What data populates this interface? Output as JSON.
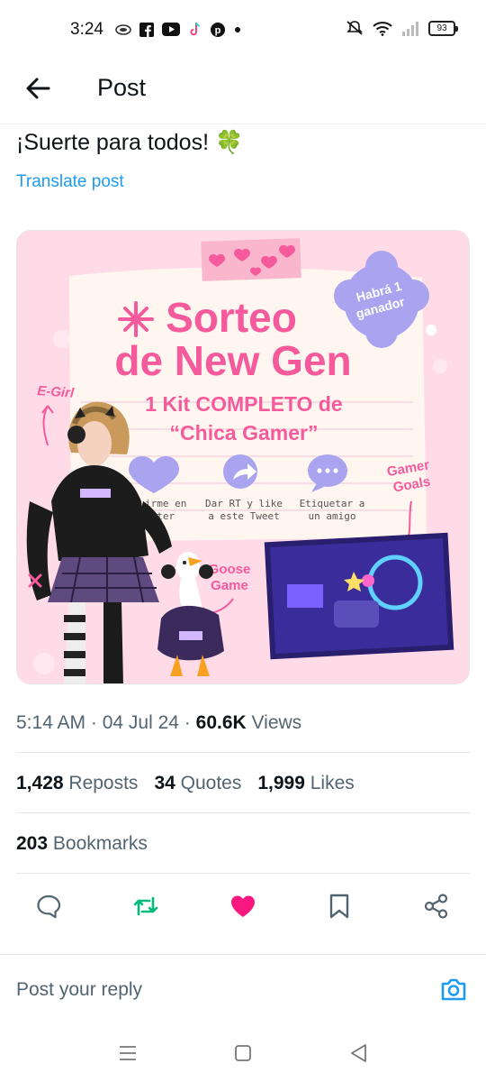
{
  "status_bar": {
    "time": "3:24",
    "battery": "93",
    "left_icons": [
      "cloud-sync-icon",
      "facebook-icon",
      "youtube-icon",
      "tiktok-icon",
      "pinterest-icon",
      "dot-icon"
    ],
    "right_icons": [
      "mute-icon",
      "wifi-icon",
      "signal-icon",
      "battery-icon"
    ]
  },
  "header": {
    "title": "Post"
  },
  "post": {
    "text": "¡Suerte para todos! 🍀",
    "translate_label": "Translate post"
  },
  "media": {
    "title_line1": "Sorteo",
    "title_line2": "de New Gen",
    "subtitle_line1": "1 Kit COMPLETO de",
    "subtitle_line2": "“Chica Gamer”",
    "badge_line1": "Habrá 1",
    "badge_line2": "ganador",
    "step1_line1": "Seguirme en",
    "step1_line2": "Twitter",
    "step2_line1": "Dar RT y like",
    "step2_line2": "a este Tweet",
    "step3_line1": "Etiquetar a",
    "step3_line2": "un amigo",
    "label_egirl": "E-Girl",
    "label_gamer_line1": "Gamer",
    "label_gamer_line2": "Goals",
    "label_goose_line1": "Goose",
    "label_goose_line2": "Game",
    "colors": {
      "background": "#ffdbe8",
      "pink": "#f55b9c",
      "purple": "#a9a3f0"
    }
  },
  "meta": {
    "time": "5:14 AM",
    "sep1": " · ",
    "date": "04 Jul 24",
    "sep2": " · ",
    "views_count": "60.6K",
    "views_label": " Views"
  },
  "stats": {
    "reposts_count": "1,428",
    "reposts_label": " Reposts",
    "quotes_count": "34",
    "quotes_label": " Quotes",
    "likes_count": "1,999",
    "likes_label": " Likes",
    "bookmarks_count": "203",
    "bookmarks_label": " Bookmarks"
  },
  "actions": {
    "icons": [
      "reply-icon",
      "repost-icon",
      "like-icon",
      "bookmark-icon",
      "share-icon"
    ],
    "repost_color": "#00ba7c",
    "like_color": "#f91880"
  },
  "reply": {
    "placeholder": "Post your reply",
    "accent": "#1d9bf0"
  },
  "nav": {
    "icons": [
      "recents-icon",
      "home-icon",
      "back-icon"
    ]
  }
}
